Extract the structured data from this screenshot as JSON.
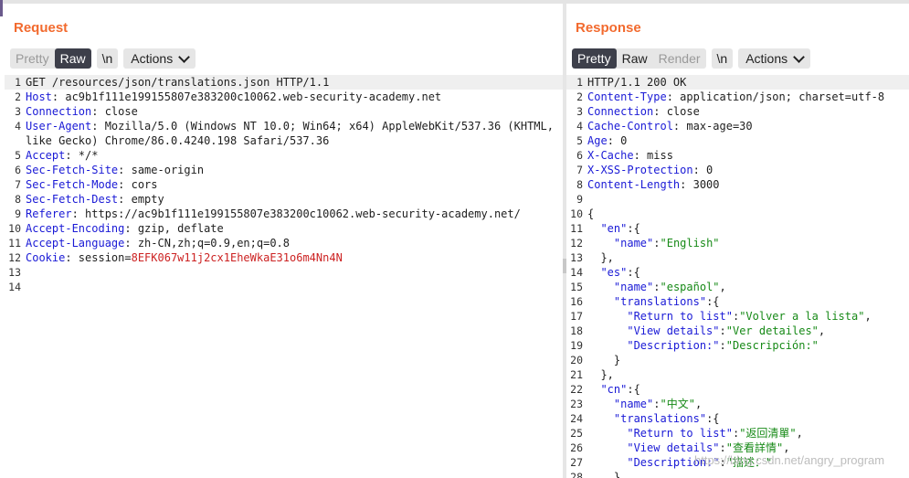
{
  "request": {
    "title": "Request",
    "tabs": [
      "Pretty",
      "Raw"
    ],
    "newline_label": "\\n",
    "actions_label": "Actions",
    "lines": [
      {
        "n": "1",
        "key": "",
        "value": "GET /resources/json/translations.json HTTP/1.1"
      },
      {
        "n": "2",
        "key": "Host",
        "value": ": ac9b1f111e199155807e383200c10062.web-security-academy.net"
      },
      {
        "n": "3",
        "key": "Connection",
        "value": ": close"
      },
      {
        "n": "4",
        "key": "User-Agent",
        "value": ": Mozilla/5.0 (Windows NT 10.0; Win64; x64) AppleWebKit/537.36 (KHTML,"
      },
      {
        "n": "",
        "key": "",
        "value": "like Gecko) Chrome/86.0.4240.198 Safari/537.36"
      },
      {
        "n": "5",
        "key": "Accept",
        "value": ": */*"
      },
      {
        "n": "6",
        "key": "Sec-Fetch-Site",
        "value": ": same-origin"
      },
      {
        "n": "7",
        "key": "Sec-Fetch-Mode",
        "value": ": cors"
      },
      {
        "n": "8",
        "key": "Sec-Fetch-Dest",
        "value": ": empty"
      },
      {
        "n": "9",
        "key": "Referer",
        "value": ": https://ac9b1f111e199155807e383200c10062.web-security-academy.net/"
      },
      {
        "n": "10",
        "key": "Accept-Encoding",
        "value": ": gzip, deflate"
      },
      {
        "n": "11",
        "key": "Accept-Language",
        "value": ": zh-CN,zh;q=0.9,en;q=0.8"
      },
      {
        "n": "12",
        "key": "Cookie",
        "value": ": session=",
        "red": "8EFK067w11j2cx1EheWkaE31o6m4Nn4N"
      },
      {
        "n": "13",
        "key": "",
        "value": ""
      },
      {
        "n": "14",
        "key": "",
        "value": ""
      }
    ]
  },
  "response": {
    "title": "Response",
    "tabs": [
      "Pretty",
      "Raw",
      "Render"
    ],
    "newline_label": "\\n",
    "actions_label": "Actions",
    "lines": [
      {
        "n": "1",
        "key": "",
        "value": "HTTP/1.1 200 OK"
      },
      {
        "n": "2",
        "key": "Content-Type",
        "value": ": application/json; charset=utf-8"
      },
      {
        "n": "3",
        "key": "Connection",
        "value": ": close"
      },
      {
        "n": "4",
        "key": "Cache-Control",
        "value": ": max-age=30"
      },
      {
        "n": "5",
        "key": "Age",
        "value": ": 0"
      },
      {
        "n": "6",
        "key": "X-Cache",
        "value": ": miss"
      },
      {
        "n": "7",
        "key": "X-XSS-Protection",
        "value": ": 0"
      },
      {
        "n": "8",
        "key": "Content-Length",
        "value": ": 3000"
      },
      {
        "n": "9",
        "key": "",
        "value": ""
      },
      {
        "n": "10",
        "key": "",
        "value": "{"
      },
      {
        "n": "11",
        "key": "",
        "value": "  \"en\":{"
      },
      {
        "n": "12",
        "key": "",
        "value": "    \"name\":\"English\""
      },
      {
        "n": "13",
        "key": "",
        "value": "  },"
      },
      {
        "n": "14",
        "key": "",
        "value": "  \"es\":{"
      },
      {
        "n": "15",
        "key": "",
        "value": "    \"name\":\"español\","
      },
      {
        "n": "16",
        "key": "",
        "value": "    \"translations\":{"
      },
      {
        "n": "17",
        "key": "",
        "value": "      \"Return to list\":\"Volver a la lista\","
      },
      {
        "n": "18",
        "key": "",
        "value": "      \"View details\":\"Ver detailes\","
      },
      {
        "n": "19",
        "key": "",
        "value": "      \"Description:\":\"Descripción:\""
      },
      {
        "n": "20",
        "key": "",
        "value": "    }"
      },
      {
        "n": "21",
        "key": "",
        "value": "  },"
      },
      {
        "n": "22",
        "key": "",
        "value": "  \"cn\":{"
      },
      {
        "n": "23",
        "key": "",
        "value": "    \"name\":\"中文\","
      },
      {
        "n": "24",
        "key": "",
        "value": "    \"translations\":{"
      },
      {
        "n": "25",
        "key": "",
        "value": "      \"Return to list\":\"返回清單\","
      },
      {
        "n": "26",
        "key": "",
        "value": "      \"View details\":\"查看詳情\","
      },
      {
        "n": "27",
        "key": "",
        "value": "      \"Description:\":\"描述：\""
      },
      {
        "n": "28",
        "key": "",
        "value": "    }"
      }
    ]
  },
  "watermark": "https://blog.csdn.net/angry_program",
  "colors": {
    "accent": "#f26a2e",
    "header_key": "#1a1ad6",
    "cookie_value": "#cc2222",
    "json_string": "#178a17",
    "active_tab": "#3d3f4a"
  }
}
